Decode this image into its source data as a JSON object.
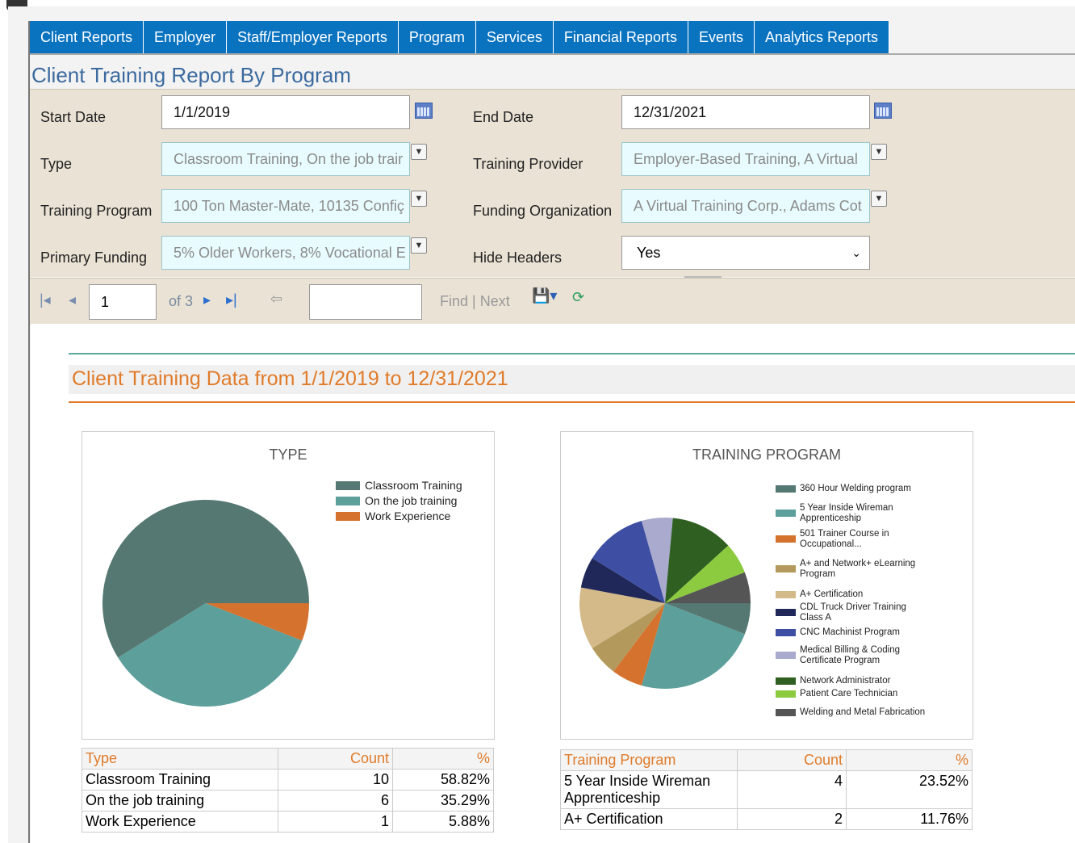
{
  "nav": {
    "tabs": [
      "Client Reports",
      "Employer",
      "Staff/Employer Reports",
      "Program",
      "Services",
      "Financial Reports",
      "Events",
      "Analytics Reports"
    ]
  },
  "page_title": "Client Training Report By Program",
  "params": {
    "start_date_label": "Start Date",
    "start_date_value": "1/1/2019",
    "end_date_label": "End Date",
    "end_date_value": "12/31/2021",
    "type_label": "Type",
    "type_value": "Classroom Training, On the job trair",
    "provider_label": "Training Provider",
    "provider_value": "Employer-Based Training, A Virtual",
    "program_label": "Training Program",
    "program_value": "100 Ton Master-Mate, 10135 Confiç",
    "funding_org_label": "Funding Organization",
    "funding_org_value": "A Virtual Training Corp., Adams Cot",
    "primary_funding_label": "Primary Funding",
    "primary_funding_value": "5% Older Workers, 8% Vocational E",
    "hide_headers_label": "Hide Headers",
    "hide_headers_value": "Yes"
  },
  "toolbar": {
    "page_value": "1",
    "of_pages": "of 3",
    "find_next": "Find | Next"
  },
  "report": {
    "title": "Client Training Data from 1/1/2019 to 12/31/2021"
  },
  "colors": {
    "nav": "#0a73c0",
    "accent_orange": "#e07b2a",
    "teal": "#5aa8a0"
  },
  "chart_data": [
    {
      "type": "pie",
      "title": "TYPE",
      "legend_position": "top-right",
      "labels": [
        "Classroom Training",
        "On the job training",
        "Work Experience"
      ],
      "legend_labels": [
        "Classroom Training",
        "On the job training",
        "Work Experience"
      ],
      "values": [
        10,
        6,
        1
      ],
      "colors": [
        "#557873",
        "#5c9f9b",
        "#d5722e"
      ]
    },
    {
      "type": "pie",
      "title": "TRAINING PROGRAM",
      "legend_position": "right",
      "labels": [
        "360 Hour Welding program",
        "5 Year Inside Wireman Apprenticeship",
        "501 Trainer Course in Occupational...",
        "A+ and Network+ eLearning Program",
        "A+ Certification",
        "CDL Truck Driver Training Class A",
        "CNC Machinist Program",
        "Medical Billing & Coding Certificate Program",
        "Network Administrator",
        "Patient Care Technician",
        "Welding and Metal Fabrication"
      ],
      "values": [
        1,
        4,
        1,
        1,
        2,
        1,
        2,
        1,
        2,
        1,
        1
      ],
      "colors": [
        "#557873",
        "#5c9f9b",
        "#d5722e",
        "#b39a5c",
        "#d4b989",
        "#20285a",
        "#3e4fa3",
        "#a9aacd",
        "#2f5f21",
        "#8ccb3f",
        "#555555"
      ]
    }
  ],
  "table_type": {
    "headers": [
      "Type",
      "Count",
      "%"
    ],
    "rows": [
      [
        "Classroom Training",
        "10",
        "58.82%"
      ],
      [
        "On the job training",
        "6",
        "35.29%"
      ],
      [
        "Work Experience",
        "1",
        "5.88%"
      ]
    ]
  },
  "table_program": {
    "headers": [
      "Training Program",
      "Count",
      "%"
    ],
    "rows": [
      [
        "5 Year Inside Wireman Apprenticeship",
        "4",
        "23.52%"
      ],
      [
        "A+ Certification",
        "2",
        "11.76%"
      ]
    ]
  }
}
